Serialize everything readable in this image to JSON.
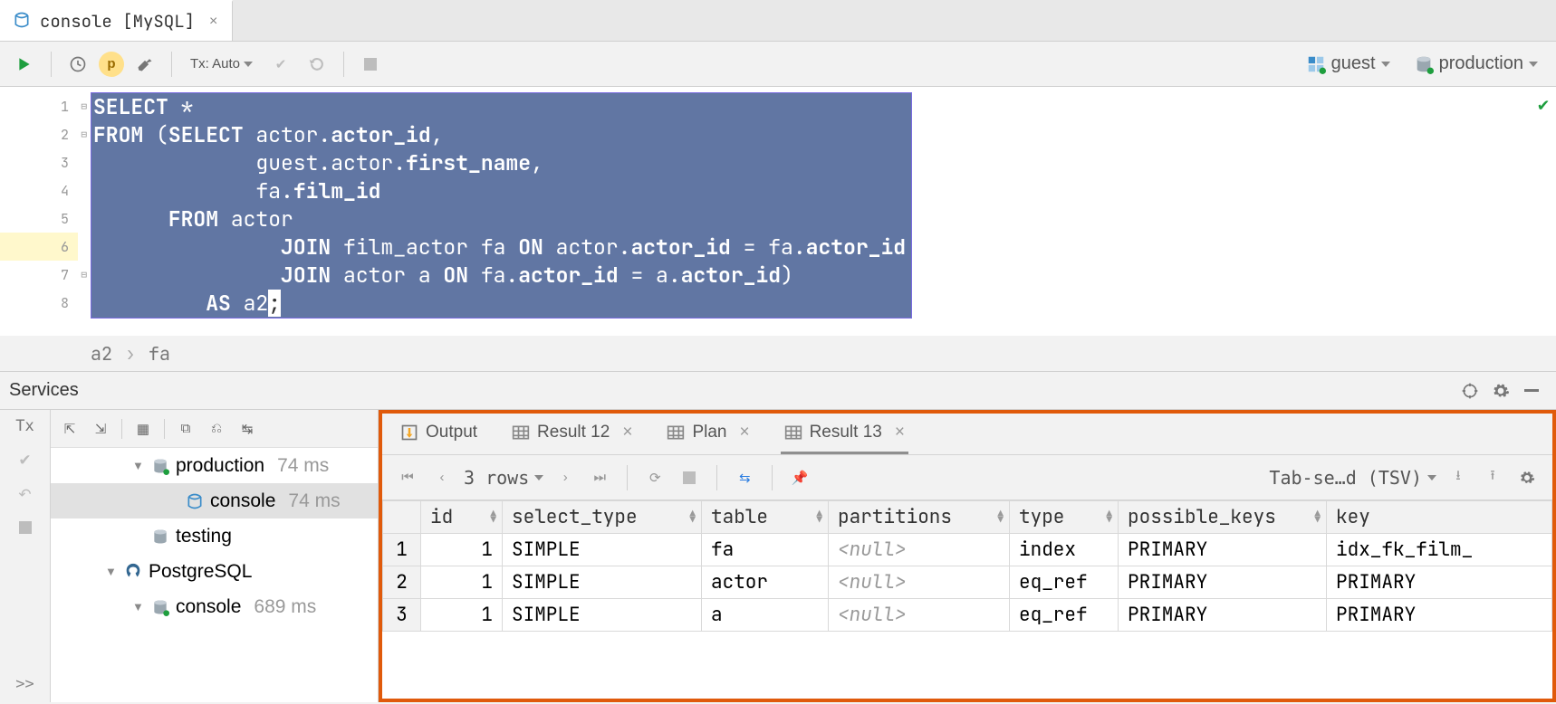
{
  "tab": {
    "label": "console [MySQL]"
  },
  "toolbar": {
    "tx_label": "Tx: Auto",
    "schema": "guest",
    "datasource": "production"
  },
  "editor": {
    "lines": [
      "1",
      "2",
      "3",
      "4",
      "5",
      "6",
      "7",
      "8"
    ],
    "code": {
      "l1a": "SELECT",
      "l1b": " *",
      "l2a": "FROM",
      "l2b": " (",
      "l2c": "SELECT",
      "l2d": " actor.",
      "l2e": "actor_id",
      "l2f": ",",
      "l3a": "             guest.actor.",
      "l3b": "first_name",
      "l3c": ",",
      "l4a": "             fa.",
      "l4b": "film_id",
      "l5a": "      ",
      "l5b": "FROM",
      "l5c": " actor",
      "l6a": "               ",
      "l6b": "JOIN",
      "l6c": " film_actor fa ",
      "l6d": "ON",
      "l6e": " actor.",
      "l6f": "actor_id",
      "l6g": " = fa.",
      "l6h": "actor_id",
      "l7a": "               ",
      "l7b": "JOIN",
      "l7c": " actor a ",
      "l7d": "ON",
      "l7e": " fa.",
      "l7f": "actor_id",
      "l7g": " = a.",
      "l7h": "actor_id",
      "l7i": ")",
      "l8a": "         ",
      "l8b": "AS",
      "l8c": " a2",
      "l8d": ";"
    }
  },
  "breadcrumb": {
    "a": "a2",
    "b": "fa"
  },
  "services": {
    "title": "Services"
  },
  "tree": {
    "prod": "production",
    "prod_ms": "74 ms",
    "console": "console",
    "console_ms": "74 ms",
    "testing": "testing",
    "pg": "PostgreSQL",
    "pg_console": "console",
    "pg_console_ms": "689 ms"
  },
  "result_tabs": {
    "output": "Output",
    "r12": "Result 12",
    "plan": "Plan",
    "r13": "Result 13"
  },
  "res_toolbar": {
    "rows": "3 rows",
    "export": "Tab-se…d (TSV)"
  },
  "grid": {
    "headers": {
      "id": "id",
      "select_type": "select_type",
      "table": "table",
      "partitions": "partitions",
      "type": "type",
      "possible_keys": "possible_keys",
      "key": "key"
    },
    "rows": [
      {
        "n": "1",
        "id": "1",
        "select_type": "SIMPLE",
        "table": "fa",
        "partitions": "<null>",
        "type": "index",
        "possible_keys": "PRIMARY",
        "key": "idx_fk_film_"
      },
      {
        "n": "2",
        "id": "1",
        "select_type": "SIMPLE",
        "table": "actor",
        "partitions": "<null>",
        "type": "eq_ref",
        "possible_keys": "PRIMARY",
        "key": "PRIMARY"
      },
      {
        "n": "3",
        "id": "1",
        "select_type": "SIMPLE",
        "table": "a",
        "partitions": "<null>",
        "type": "eq_ref",
        "possible_keys": "PRIMARY",
        "key": "PRIMARY"
      }
    ]
  },
  "left_gutter": {
    "tx": "Tx",
    "more": ">>"
  }
}
